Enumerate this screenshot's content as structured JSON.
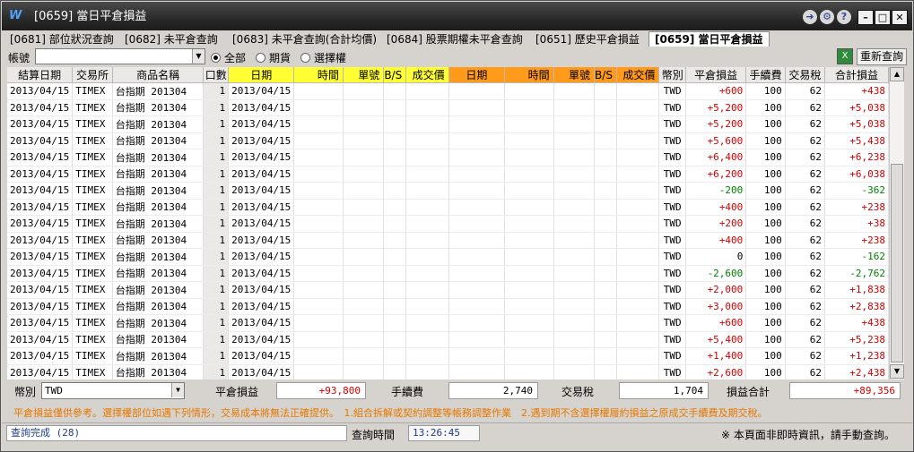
{
  "window": {
    "title": "[0659] 當日平倉損益",
    "logo": "W"
  },
  "tabs": [
    {
      "label": "[0681] 部位狀況查詢",
      "active": false
    },
    {
      "label": "[0682] 未平倉查詢",
      "active": false
    },
    {
      "label": "[0683] 未平倉查詢(合計均價)",
      "active": false
    },
    {
      "label": "[0684] 股票期權未平倉查詢",
      "active": false
    },
    {
      "label": "[0651] 歷史平倉損益",
      "active": false
    },
    {
      "label": "[0659] 當日平倉損益",
      "active": true
    }
  ],
  "toolbar": {
    "account_label": "帳號",
    "account_value": "",
    "radios": [
      {
        "label": "全部",
        "checked": true
      },
      {
        "label": "期貨",
        "checked": false
      },
      {
        "label": "選擇權",
        "checked": false
      }
    ],
    "reload_label": "重新查詢"
  },
  "columns": [
    "結算日期",
    "交易所",
    "商品名稱",
    "口數",
    "日期",
    "時間",
    "單號",
    "B/S",
    "成交價",
    "日期",
    "時間",
    "單號",
    "B/S",
    "成交價",
    "幣別",
    "平倉損益",
    "手續費",
    "交易稅",
    "合計損益"
  ],
  "rows": [
    [
      "2013/04/15",
      "TIMEX",
      "台指期 201304",
      "1",
      "2013/04/15",
      "",
      "",
      "",
      "",
      "",
      "",
      "",
      "",
      "",
      "TWD",
      "+600",
      "100",
      "62",
      "+438"
    ],
    [
      "2013/04/15",
      "TIMEX",
      "台指期 201304",
      "1",
      "2013/04/15",
      "",
      "",
      "",
      "",
      "",
      "",
      "",
      "",
      "",
      "TWD",
      "+5,200",
      "100",
      "62",
      "+5,038"
    ],
    [
      "2013/04/15",
      "TIMEX",
      "台指期 201304",
      "1",
      "2013/04/15",
      "",
      "",
      "",
      "",
      "",
      "",
      "",
      "",
      "",
      "TWD",
      "+5,200",
      "100",
      "62",
      "+5,038"
    ],
    [
      "2013/04/15",
      "TIMEX",
      "台指期 201304",
      "1",
      "2013/04/15",
      "",
      "",
      "",
      "",
      "",
      "",
      "",
      "",
      "",
      "TWD",
      "+5,600",
      "100",
      "62",
      "+5,438"
    ],
    [
      "2013/04/15",
      "TIMEX",
      "台指期 201304",
      "1",
      "2013/04/15",
      "",
      "",
      "",
      "",
      "",
      "",
      "",
      "",
      "",
      "TWD",
      "+6,400",
      "100",
      "62",
      "+6,238"
    ],
    [
      "2013/04/15",
      "TIMEX",
      "台指期 201304",
      "1",
      "2013/04/15",
      "",
      "",
      "",
      "",
      "",
      "",
      "",
      "",
      "",
      "TWD",
      "+6,200",
      "100",
      "62",
      "+6,038"
    ],
    [
      "2013/04/15",
      "TIMEX",
      "台指期 201304",
      "1",
      "2013/04/15",
      "",
      "",
      "",
      "",
      "",
      "",
      "",
      "",
      "",
      "TWD",
      "-200",
      "100",
      "62",
      "-362"
    ],
    [
      "2013/04/15",
      "TIMEX",
      "台指期 201304",
      "1",
      "2013/04/15",
      "",
      "",
      "",
      "",
      "",
      "",
      "",
      "",
      "",
      "TWD",
      "+400",
      "100",
      "62",
      "+238"
    ],
    [
      "2013/04/15",
      "TIMEX",
      "台指期 201304",
      "1",
      "2013/04/15",
      "",
      "",
      "",
      "",
      "",
      "",
      "",
      "",
      "",
      "TWD",
      "+200",
      "100",
      "62",
      "+38"
    ],
    [
      "2013/04/15",
      "TIMEX",
      "台指期 201304",
      "1",
      "2013/04/15",
      "",
      "",
      "",
      "",
      "",
      "",
      "",
      "",
      "",
      "TWD",
      "+400",
      "100",
      "62",
      "+238"
    ],
    [
      "2013/04/15",
      "TIMEX",
      "台指期 201304",
      "1",
      "2013/04/15",
      "",
      "",
      "",
      "",
      "",
      "",
      "",
      "",
      "",
      "TWD",
      "0",
      "100",
      "62",
      "-162"
    ],
    [
      "2013/04/15",
      "TIMEX",
      "台指期 201304",
      "1",
      "2013/04/15",
      "",
      "",
      "",
      "",
      "",
      "",
      "",
      "",
      "",
      "TWD",
      "-2,600",
      "100",
      "62",
      "-2,762"
    ],
    [
      "2013/04/15",
      "TIMEX",
      "台指期 201304",
      "1",
      "2013/04/15",
      "",
      "",
      "",
      "",
      "",
      "",
      "",
      "",
      "",
      "TWD",
      "+2,000",
      "100",
      "62",
      "+1,838"
    ],
    [
      "2013/04/15",
      "TIMEX",
      "台指期 201304",
      "1",
      "2013/04/15",
      "",
      "",
      "",
      "",
      "",
      "",
      "",
      "",
      "",
      "TWD",
      "+3,000",
      "100",
      "62",
      "+2,838"
    ],
    [
      "2013/04/15",
      "TIMEX",
      "台指期 201304",
      "1",
      "2013/04/15",
      "",
      "",
      "",
      "",
      "",
      "",
      "",
      "",
      "",
      "TWD",
      "+600",
      "100",
      "62",
      "+438"
    ],
    [
      "2013/04/15",
      "TIMEX",
      "台指期 201304",
      "1",
      "2013/04/15",
      "",
      "",
      "",
      "",
      "",
      "",
      "",
      "",
      "",
      "TWD",
      "+5,400",
      "100",
      "62",
      "+5,238"
    ],
    [
      "2013/04/15",
      "TIMEX",
      "台指期 201304",
      "1",
      "2013/04/15",
      "",
      "",
      "",
      "",
      "",
      "",
      "",
      "",
      "",
      "TWD",
      "+1,400",
      "100",
      "62",
      "+1,238"
    ],
    [
      "2013/04/15",
      "TIMEX",
      "台指期 201304",
      "1",
      "2013/04/15",
      "",
      "",
      "",
      "",
      "",
      "",
      "",
      "",
      "",
      "TWD",
      "+2,600",
      "100",
      "62",
      "+2,438"
    ]
  ],
  "footer": {
    "currency_label": "幣別",
    "currency_value": "TWD",
    "pnl_label": "平倉損益",
    "pnl_value": "+93,800",
    "fee_label": "手續費",
    "fee_value": "2,740",
    "tax_label": "交易稅",
    "tax_value": "1,704",
    "total_label": "損益合計",
    "total_value": "+89,356"
  },
  "note": "平倉損益僅供參考。選擇權部位如遇下列情形，交易成本將無法正確提供。　1.組合拆解或契約調整等帳務調整作業　2.遇到期不含選擇權履約損益之原成交手續費及期交稅。",
  "status": {
    "message": "查詢完成 (28)",
    "time_label": "查詢時間",
    "time_value": "13:26:45",
    "notice": "※ 本頁面非即時資訊，請手動查詢。"
  },
  "colors": {
    "positive": "#d40000",
    "negative": "#008000",
    "open_header": "#ffff33",
    "close_header": "#ff9a1a"
  }
}
